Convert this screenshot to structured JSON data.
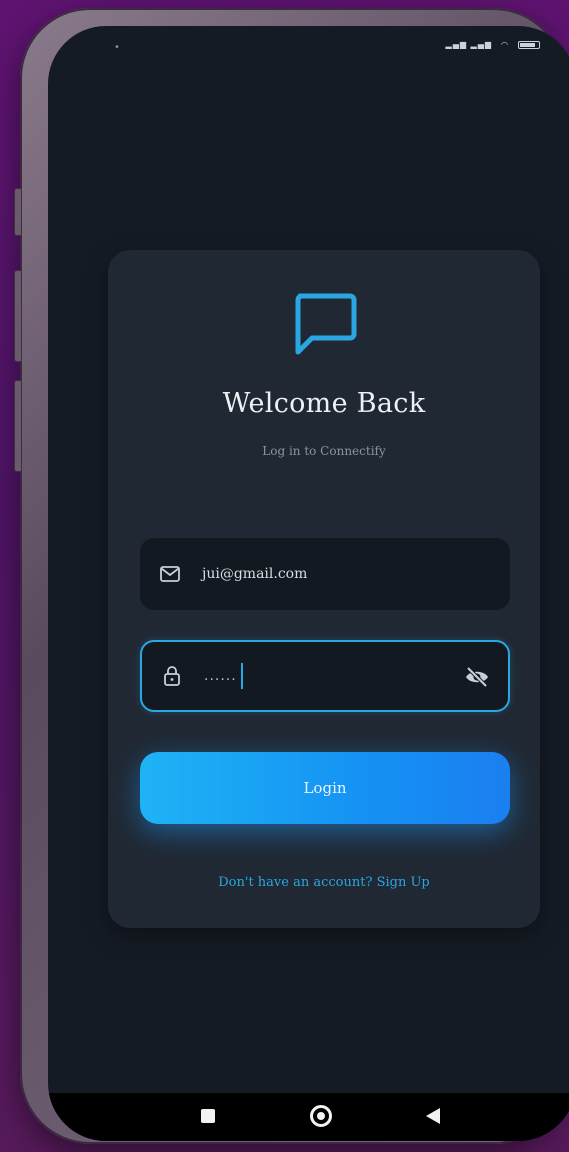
{
  "app": {
    "name": "Connectify"
  },
  "login": {
    "title": "Welcome Back",
    "subtitle": "Log in to Connectify",
    "email_value": "jui@gmail.com",
    "password_masked": "......",
    "login_label": "Login",
    "signup_prompt": "Don't have an account?",
    "signup_link": "Sign Up"
  },
  "icons": {
    "logo": "chat-bubble-icon",
    "email": "mail-icon",
    "password": "lock-icon",
    "visibility": "eye-off-icon"
  },
  "colors": {
    "accent": "#2aa7e3",
    "background": "#151b24",
    "card": "#202833",
    "field": "#131920",
    "button_gradient_start": "#1fb3f5",
    "button_gradient_end": "#1a7ff0"
  }
}
